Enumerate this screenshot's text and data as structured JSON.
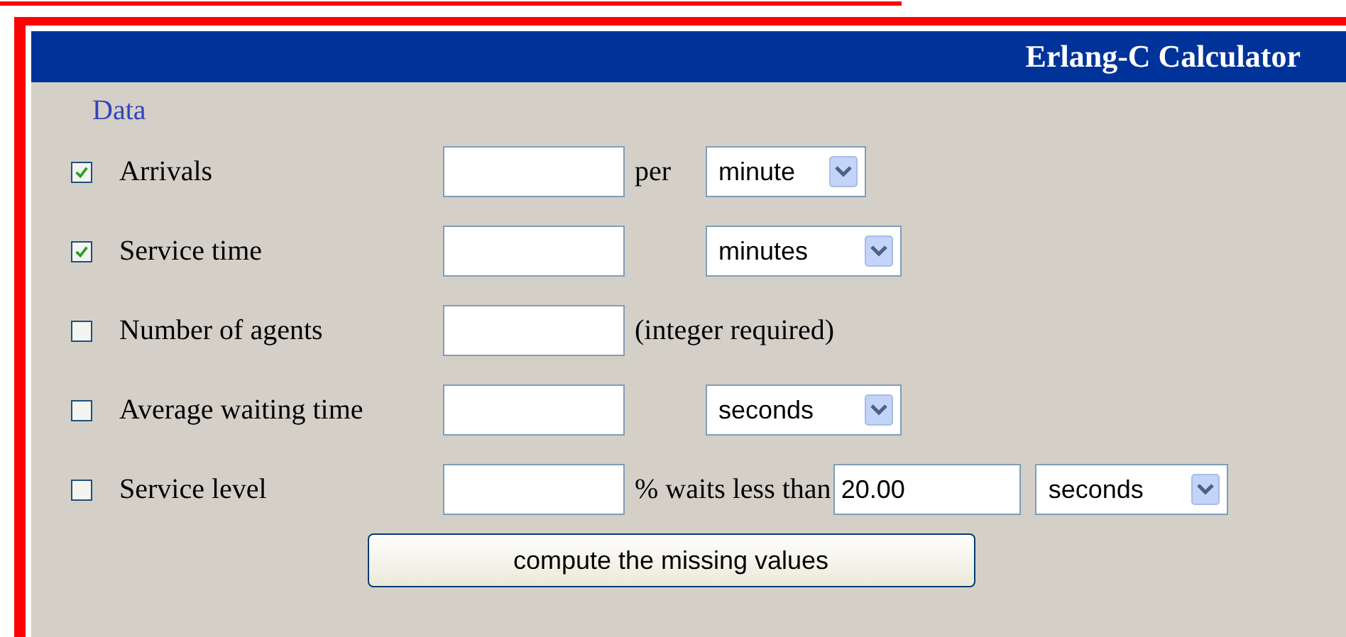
{
  "title": "Erlang-C Calculator",
  "section": "Data",
  "rows": [
    {
      "label": "Arrivals",
      "checked": true,
      "value": "",
      "between": "per",
      "unit": "minute"
    },
    {
      "label": "Service time",
      "checked": true,
      "value": "",
      "unit": "minutes"
    },
    {
      "label": "Number of agents",
      "checked": false,
      "value": "",
      "between": "(integer required)"
    },
    {
      "label": "Average waiting time",
      "checked": false,
      "value": "",
      "unit": "seconds"
    },
    {
      "label": "Service level",
      "checked": false,
      "value": "",
      "between": "% waits less than",
      "threshold": "20.00",
      "unit": "seconds"
    }
  ],
  "button": "compute the missing values"
}
